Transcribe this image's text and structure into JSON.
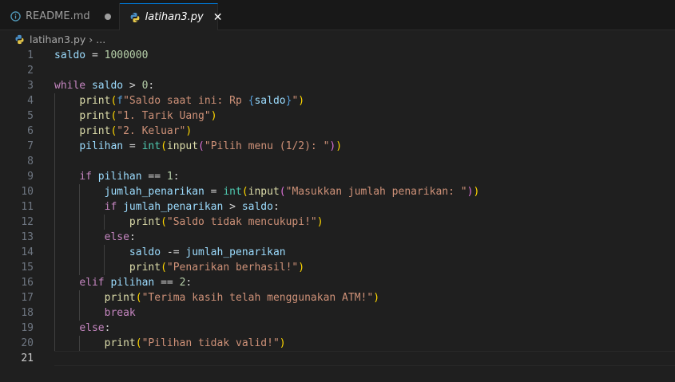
{
  "tabs": [
    {
      "label": "README.md",
      "icon": "info-icon",
      "modified": true,
      "active": false
    },
    {
      "label": "latihan3.py",
      "icon": "python-icon",
      "modified": false,
      "active": true
    }
  ],
  "breadcrumb": {
    "file": "latihan3.py",
    "more": "..."
  },
  "colors": {
    "keyword": "#c586c0",
    "function": "#dcdcaa",
    "string": "#ce9178",
    "variable": "#9cdcfe",
    "number": "#b5cea8",
    "active_tab_border": "#0078d4"
  },
  "editor": {
    "current_line": 21,
    "lines": [
      {
        "n": "1",
        "indent": 0,
        "tokens": [
          {
            "t": "saldo",
            "c": "var"
          },
          {
            "t": " = ",
            "c": "op"
          },
          {
            "t": "1000000",
            "c": "num"
          }
        ]
      },
      {
        "n": "2",
        "indent": 0,
        "tokens": []
      },
      {
        "n": "3",
        "indent": 0,
        "tokens": [
          {
            "t": "while",
            "c": "kw"
          },
          {
            "t": " ",
            "c": "op"
          },
          {
            "t": "saldo",
            "c": "var"
          },
          {
            "t": " > ",
            "c": "op"
          },
          {
            "t": "0",
            "c": "num"
          },
          {
            "t": ":",
            "c": "op"
          }
        ]
      },
      {
        "n": "4",
        "indent": 1,
        "tokens": [
          {
            "t": "print",
            "c": "fn"
          },
          {
            "t": "(",
            "c": "br1"
          },
          {
            "t": "f",
            "c": "bl"
          },
          {
            "t": "\"Saldo saat ini: Rp ",
            "c": "str"
          },
          {
            "t": "{",
            "c": "bl"
          },
          {
            "t": "saldo",
            "c": "var"
          },
          {
            "t": "}",
            "c": "bl"
          },
          {
            "t": "\"",
            "c": "str"
          },
          {
            "t": ")",
            "c": "br1"
          }
        ]
      },
      {
        "n": "5",
        "indent": 1,
        "tokens": [
          {
            "t": "print",
            "c": "fn"
          },
          {
            "t": "(",
            "c": "br1"
          },
          {
            "t": "\"1. Tarik Uang\"",
            "c": "str"
          },
          {
            "t": ")",
            "c": "br1"
          }
        ]
      },
      {
        "n": "6",
        "indent": 1,
        "tokens": [
          {
            "t": "print",
            "c": "fn"
          },
          {
            "t": "(",
            "c": "br1"
          },
          {
            "t": "\"2. Keluar\"",
            "c": "str"
          },
          {
            "t": ")",
            "c": "br1"
          }
        ]
      },
      {
        "n": "7",
        "indent": 1,
        "tokens": [
          {
            "t": "pilihan",
            "c": "var"
          },
          {
            "t": " = ",
            "c": "op"
          },
          {
            "t": "int",
            "c": "cls"
          },
          {
            "t": "(",
            "c": "br1"
          },
          {
            "t": "input",
            "c": "fn"
          },
          {
            "t": "(",
            "c": "br2"
          },
          {
            "t": "\"Pilih menu (1/2): \"",
            "c": "str"
          },
          {
            "t": ")",
            "c": "br2"
          },
          {
            "t": ")",
            "c": "br1"
          }
        ]
      },
      {
        "n": "8",
        "indent": 1,
        "tokens": []
      },
      {
        "n": "9",
        "indent": 1,
        "tokens": [
          {
            "t": "if",
            "c": "kw"
          },
          {
            "t": " ",
            "c": "op"
          },
          {
            "t": "pilihan",
            "c": "var"
          },
          {
            "t": " == ",
            "c": "op"
          },
          {
            "t": "1",
            "c": "num"
          },
          {
            "t": ":",
            "c": "op"
          }
        ]
      },
      {
        "n": "10",
        "indent": 2,
        "tokens": [
          {
            "t": "jumlah_penarikan",
            "c": "var"
          },
          {
            "t": " = ",
            "c": "op"
          },
          {
            "t": "int",
            "c": "cls"
          },
          {
            "t": "(",
            "c": "br1"
          },
          {
            "t": "input",
            "c": "fn"
          },
          {
            "t": "(",
            "c": "br2"
          },
          {
            "t": "\"Masukkan jumlah penarikan: \"",
            "c": "str"
          },
          {
            "t": ")",
            "c": "br2"
          },
          {
            "t": ")",
            "c": "br1"
          }
        ]
      },
      {
        "n": "11",
        "indent": 2,
        "tokens": [
          {
            "t": "if",
            "c": "kw"
          },
          {
            "t": " ",
            "c": "op"
          },
          {
            "t": "jumlah_penarikan",
            "c": "var"
          },
          {
            "t": " > ",
            "c": "op"
          },
          {
            "t": "saldo",
            "c": "var"
          },
          {
            "t": ":",
            "c": "op"
          }
        ]
      },
      {
        "n": "12",
        "indent": 3,
        "tokens": [
          {
            "t": "print",
            "c": "fn"
          },
          {
            "t": "(",
            "c": "br1"
          },
          {
            "t": "\"Saldo tidak mencukupi!\"",
            "c": "str"
          },
          {
            "t": ")",
            "c": "br1"
          }
        ]
      },
      {
        "n": "13",
        "indent": 2,
        "tokens": [
          {
            "t": "else",
            "c": "kw"
          },
          {
            "t": ":",
            "c": "op"
          }
        ]
      },
      {
        "n": "14",
        "indent": 3,
        "tokens": [
          {
            "t": "saldo",
            "c": "var"
          },
          {
            "t": " -= ",
            "c": "op"
          },
          {
            "t": "jumlah_penarikan",
            "c": "var"
          }
        ]
      },
      {
        "n": "15",
        "indent": 3,
        "tokens": [
          {
            "t": "print",
            "c": "fn"
          },
          {
            "t": "(",
            "c": "br1"
          },
          {
            "t": "\"Penarikan berhasil!\"",
            "c": "str"
          },
          {
            "t": ")",
            "c": "br1"
          }
        ]
      },
      {
        "n": "16",
        "indent": 1,
        "tokens": [
          {
            "t": "elif",
            "c": "kw"
          },
          {
            "t": " ",
            "c": "op"
          },
          {
            "t": "pilihan",
            "c": "var"
          },
          {
            "t": " == ",
            "c": "op"
          },
          {
            "t": "2",
            "c": "num"
          },
          {
            "t": ":",
            "c": "op"
          }
        ]
      },
      {
        "n": "17",
        "indent": 2,
        "tokens": [
          {
            "t": "print",
            "c": "fn"
          },
          {
            "t": "(",
            "c": "br1"
          },
          {
            "t": "\"Terima kasih telah menggunakan ATM!\"",
            "c": "str"
          },
          {
            "t": ")",
            "c": "br1"
          }
        ]
      },
      {
        "n": "18",
        "indent": 2,
        "tokens": [
          {
            "t": "break",
            "c": "kw"
          }
        ]
      },
      {
        "n": "19",
        "indent": 1,
        "tokens": [
          {
            "t": "else",
            "c": "kw"
          },
          {
            "t": ":",
            "c": "op"
          }
        ]
      },
      {
        "n": "20",
        "indent": 2,
        "tokens": [
          {
            "t": "print",
            "c": "fn"
          },
          {
            "t": "(",
            "c": "br1"
          },
          {
            "t": "\"Pilihan tidak valid!\"",
            "c": "str"
          },
          {
            "t": ")",
            "c": "br1"
          }
        ]
      },
      {
        "n": "21",
        "indent": 0,
        "tokens": []
      }
    ]
  }
}
